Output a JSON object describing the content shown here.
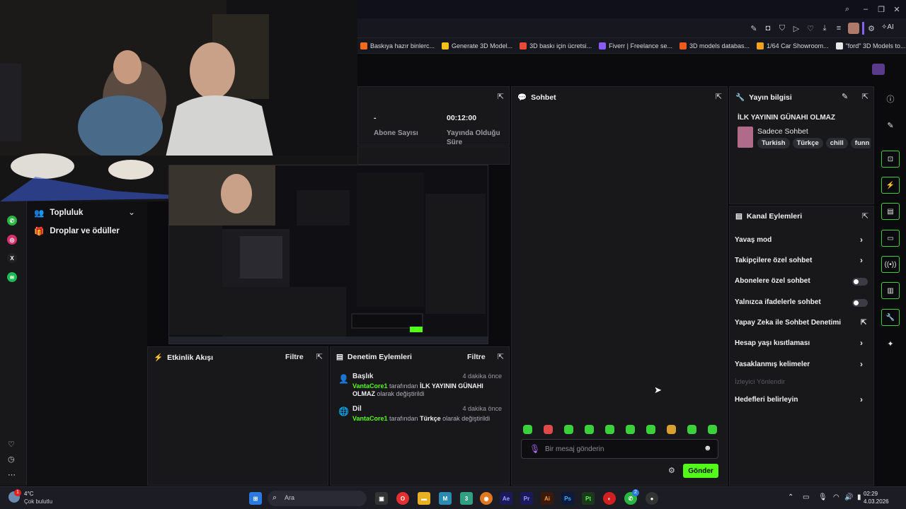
{
  "browser": {
    "titlebar_icons": [
      "search-icon",
      "minimize-icon",
      "restore-icon",
      "close-icon"
    ],
    "toolbar_ai_label": "AI",
    "bookmarks": [
      {
        "label": "Baskıya hazır binlerc...",
        "color": "#ff6a1a"
      },
      {
        "label": "Generate 3D Model...",
        "color": "#f2c21b"
      },
      {
        "label": "3D baskı için ücretsi...",
        "color": "#e84a3a"
      },
      {
        "label": "Fiverr | Freelance se...",
        "color": "#8a5cf6"
      },
      {
        "label": "3D models databas...",
        "color": "#ef5a1e"
      },
      {
        "label": "1/64 Car Showroom...",
        "color": "#f6a21a"
      },
      {
        "label": "\"ford\" 3D Models to...",
        "color": "#e8e8e8"
      }
    ]
  },
  "left_menu": {
    "community": "Topluluk",
    "drops": "Droplar ve ödüller"
  },
  "stats": {
    "subs_value": "-",
    "subs_label": "Abone Sayısı",
    "time_value": "00:12:00",
    "time_label": "Yayında Olduğu Süre"
  },
  "chat": {
    "title": "Sohbet",
    "placeholder": "Bir mesaj gönderin",
    "send": "Gönder",
    "emote_colors": [
      "#3bd13b",
      "#e04a4a",
      "#3bd13b",
      "#3bd13b",
      "#3bd13b",
      "#3bd13b",
      "#3bd13b",
      "#d8a030",
      "#3bd13b",
      "#3bd13b"
    ]
  },
  "activity": {
    "title": "Etkinlik Akışı",
    "filter": "Filtre"
  },
  "moderation": {
    "title": "Denetim Eylemleri",
    "filter": "Filtre",
    "entries": [
      {
        "title": "Başlık",
        "time": "4 dakika önce",
        "user": "VantaCore1",
        "middle": " tarafından ",
        "value": "İLK YAYININ GÜNAHI OLMAZ",
        "suffix": " olarak değiştirildi"
      },
      {
        "title": "Dil",
        "time": "4 dakika önce",
        "user": "VantaCore1",
        "middle": " tarafından ",
        "value": "Türkçe",
        "suffix": " olarak değiştirildi"
      }
    ]
  },
  "stream_info": {
    "title": "Yayın bilgisi",
    "stream_title": "İLK YAYININ GÜNAHI OLMAZ",
    "category": "Sadece Sohbet",
    "tags": [
      "Turkish",
      "Türkçe",
      "chill",
      "funn"
    ]
  },
  "channel_actions": {
    "title": "Kanal Eylemleri",
    "items": [
      {
        "label": "Yavaş mod",
        "control": "chevron"
      },
      {
        "label": "Takipçilere özel sohbet",
        "control": "chevron"
      },
      {
        "label": "Abonelere özel sohbet",
        "control": "toggle",
        "enabled": false
      },
      {
        "label": "Yalnızca ifadelerle sohbet",
        "control": "toggle",
        "enabled": false
      },
      {
        "label": "Yapay Zeka ile Sohbet Denetimi",
        "control": "external"
      },
      {
        "label": "Hesap yaşı kısıtlaması",
        "control": "chevron"
      },
      {
        "label": "Yasaklanmış kelimeler",
        "control": "chevron"
      },
      {
        "label": "İzleyici Yönlendir",
        "control": "none",
        "disabled": true
      },
      {
        "label": "Hedefleri belirleyin",
        "control": "chevron"
      }
    ]
  },
  "taskbar": {
    "weather_temp": "4°C",
    "weather_desc": "Çok bulutlu",
    "weather_badge": "1",
    "search_label": "Ara",
    "clock_time": "02:29",
    "clock_date": "4.03.2026",
    "whatsapp_badge": "2"
  }
}
